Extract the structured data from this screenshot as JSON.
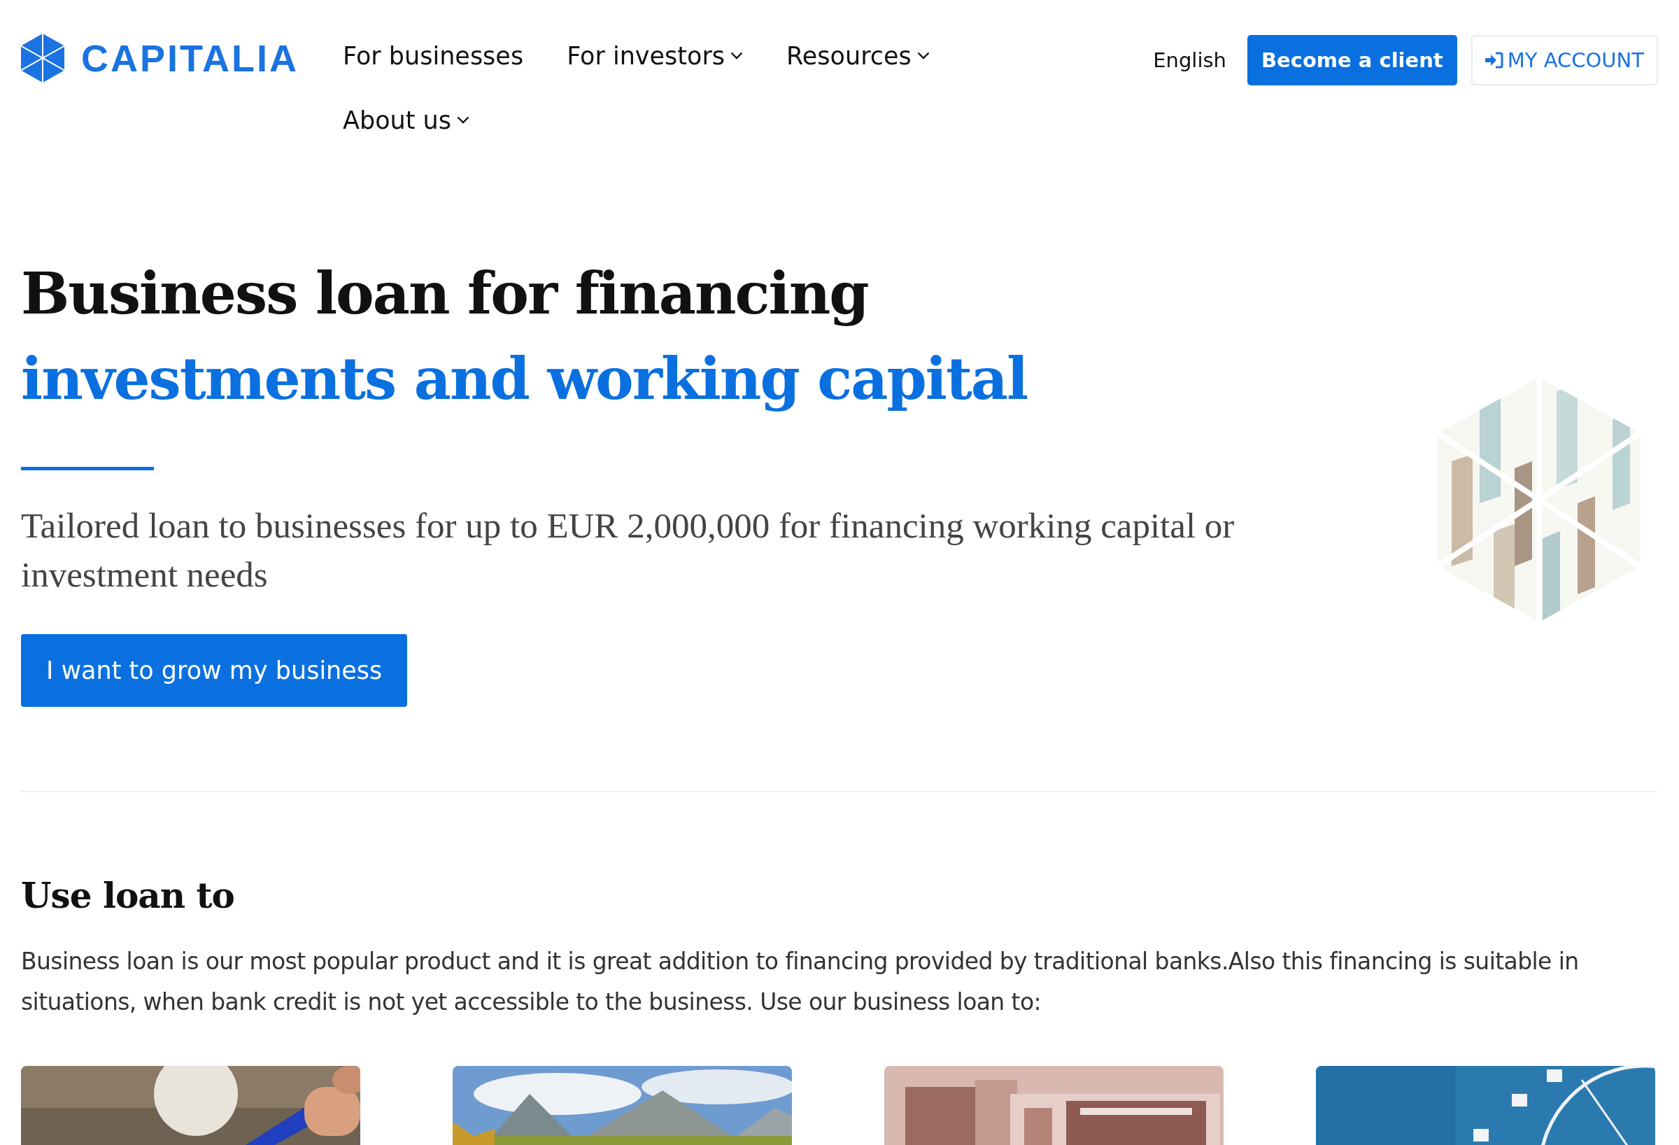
{
  "header": {
    "logo": "CAPITALIA",
    "nav": [
      {
        "label": "For businesses",
        "dropdown": false
      },
      {
        "label": "For investors",
        "dropdown": true
      },
      {
        "label": "Resources",
        "dropdown": true
      },
      {
        "label": "About us",
        "dropdown": true
      }
    ],
    "language": "English",
    "primary_button": "Become a client",
    "account_button": "MY ACCOUNT"
  },
  "hero": {
    "title_line_1": "Business loan for financing",
    "title_line_2": "investments and working capital",
    "subtitle": "Tailored loan to businesses for up to EUR 2,000,000 for financing working capital or investment needs",
    "button": "I want to grow my business"
  },
  "section": {
    "heading": "Use loan to",
    "text": "Business loan is our most popular product and it is great addition to financing provided by traditional banks.Also this financing is suitable in situations, when bank credit is not yet accessible to the business. Use our business loan to:",
    "cards": [
      {
        "kind": "pen"
      },
      {
        "kind": "mountains"
      },
      {
        "kind": "workshop"
      },
      {
        "kind": "wheel"
      }
    ]
  }
}
